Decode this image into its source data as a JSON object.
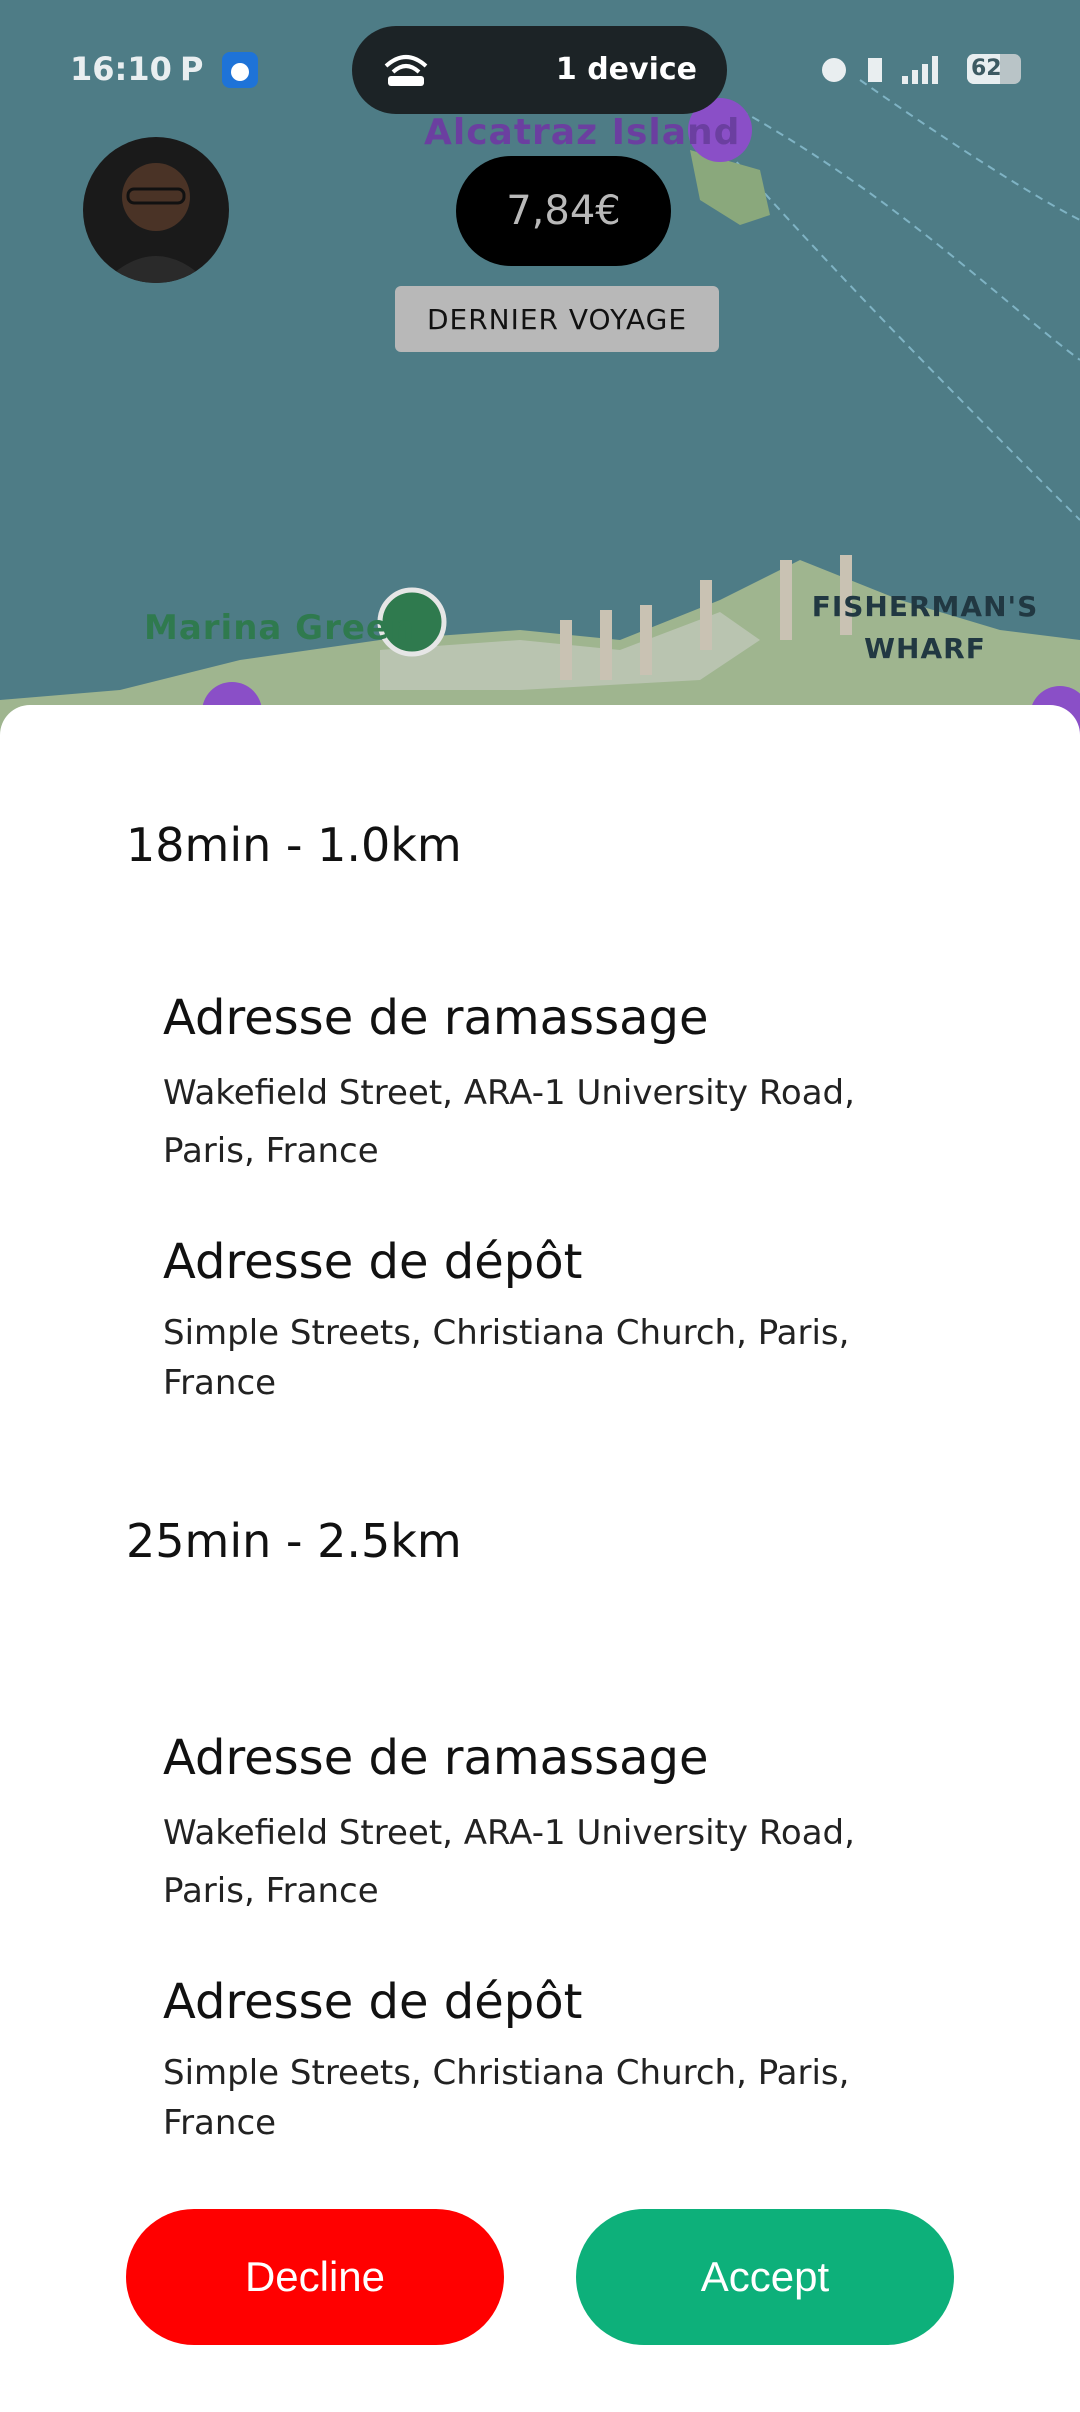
{
  "status_bar": {
    "time": "16:10",
    "p_icon": "P",
    "device_pill": "1 device",
    "battery": "62"
  },
  "map": {
    "labels": {
      "alcatraz": "Alcatraz Island",
      "marina": "Marina Green",
      "fishermans": "FISHERMAN'S",
      "wharf": "WHARF"
    }
  },
  "header": {
    "price": "7,84€",
    "last_trip_label": "DERNIER VOYAGE"
  },
  "trips": [
    {
      "meta": "18min - 1.0km",
      "pickup_title": "Adresse de ramassage",
      "pickup_line1": "Wakefield Street, ARA-1 University Road,",
      "pickup_line2": "Paris, France",
      "dropoff_title": "Adresse de dépôt",
      "dropoff_line1": "Simple Streets, Christiana Church, Paris,",
      "dropoff_line2": "France"
    },
    {
      "meta": "25min - 2.5km",
      "pickup_title": "Adresse de ramassage",
      "pickup_line1": "Wakefield Street, ARA-1 University Road,",
      "pickup_line2": "Paris, France",
      "dropoff_title": "Adresse de dépôt",
      "dropoff_line1": "Simple Streets, Christiana Church, Paris,",
      "dropoff_line2": "France"
    }
  ],
  "actions": {
    "decline": "Decline",
    "accept": "Accept"
  },
  "colors": {
    "decline": "#ff0000",
    "accept": "#0db07a",
    "map_water": "#4e7c86"
  }
}
